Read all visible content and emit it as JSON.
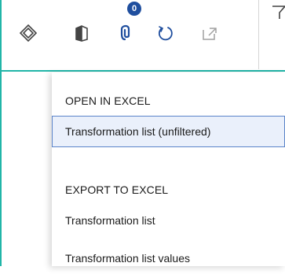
{
  "toolbar": {
    "notification_count": "0",
    "icons": [
      "diamond-icon",
      "book-icon",
      "paperclip-icon",
      "refresh-icon",
      "popout-icon",
      "filter-icon"
    ]
  },
  "menu": {
    "open_heading": "OPEN IN EXCEL",
    "open_items": [
      {
        "label": "Transformation list (unfiltered)",
        "selected": true
      }
    ],
    "export_heading": "EXPORT TO EXCEL",
    "export_items": [
      {
        "label": "Transformation list"
      },
      {
        "label": "Transformation list values"
      }
    ]
  },
  "colors": {
    "accent_teal": "#21b5a8",
    "badge_blue": "#1f4e9e",
    "selection_border": "#5b84c9",
    "selection_fill": "#eaf0fb"
  }
}
